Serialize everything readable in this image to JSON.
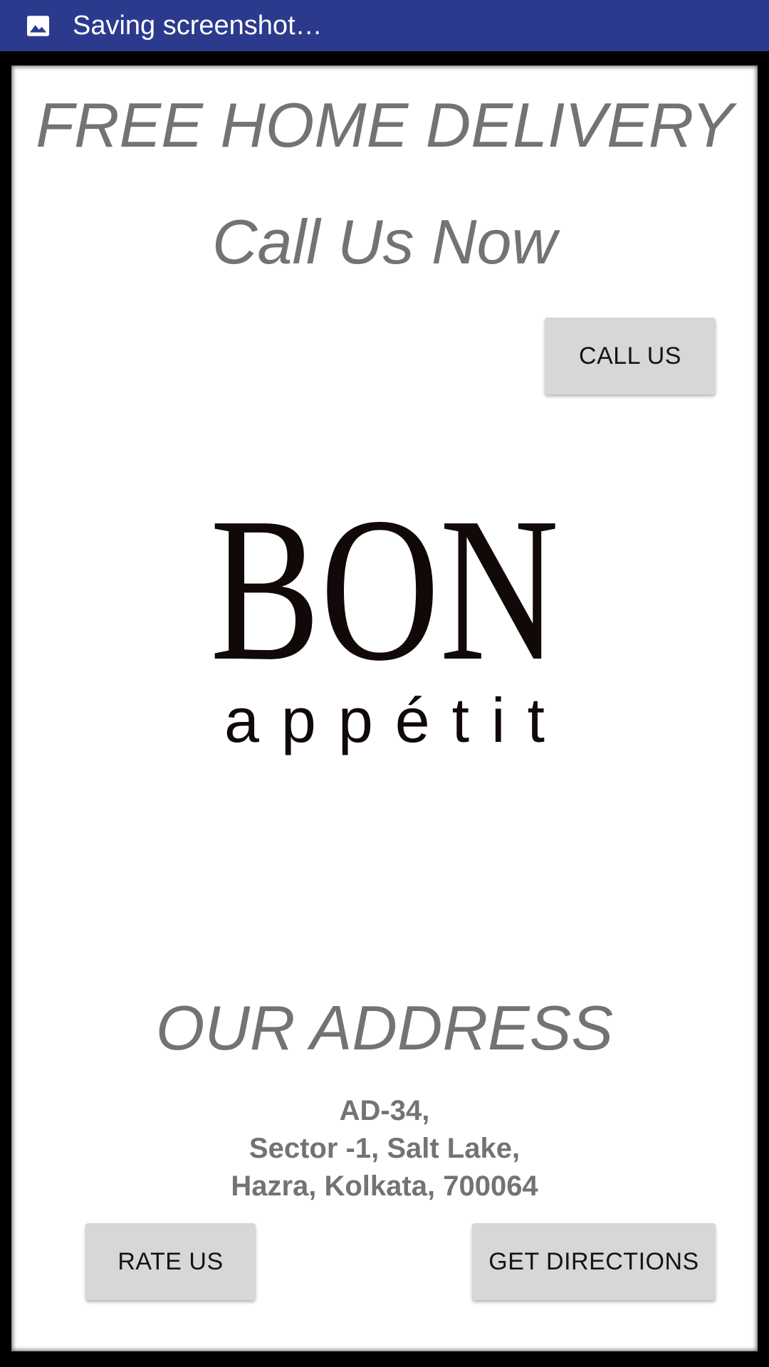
{
  "status_bar": {
    "icon": "image-icon",
    "text": "Saving screenshot…",
    "background": "#2c3a8e"
  },
  "main": {
    "headline": "FREE HOME DELIVERY",
    "subheadline": "Call Us Now",
    "call_button_label": "CALL US",
    "logo": {
      "brand": "BON",
      "tagline": "appétit"
    },
    "address_title": "OUR ADDRESS",
    "address_lines": [
      "AD-34,",
      "Sector -1, Salt Lake,",
      "Hazra, Kolkata, 700064"
    ],
    "rate_button_label": "RATE US",
    "directions_button_label": "GET DIRECTIONS"
  },
  "colors": {
    "headline_text": "#737373",
    "button_background": "#d6d7d7",
    "button_text": "#141414"
  }
}
